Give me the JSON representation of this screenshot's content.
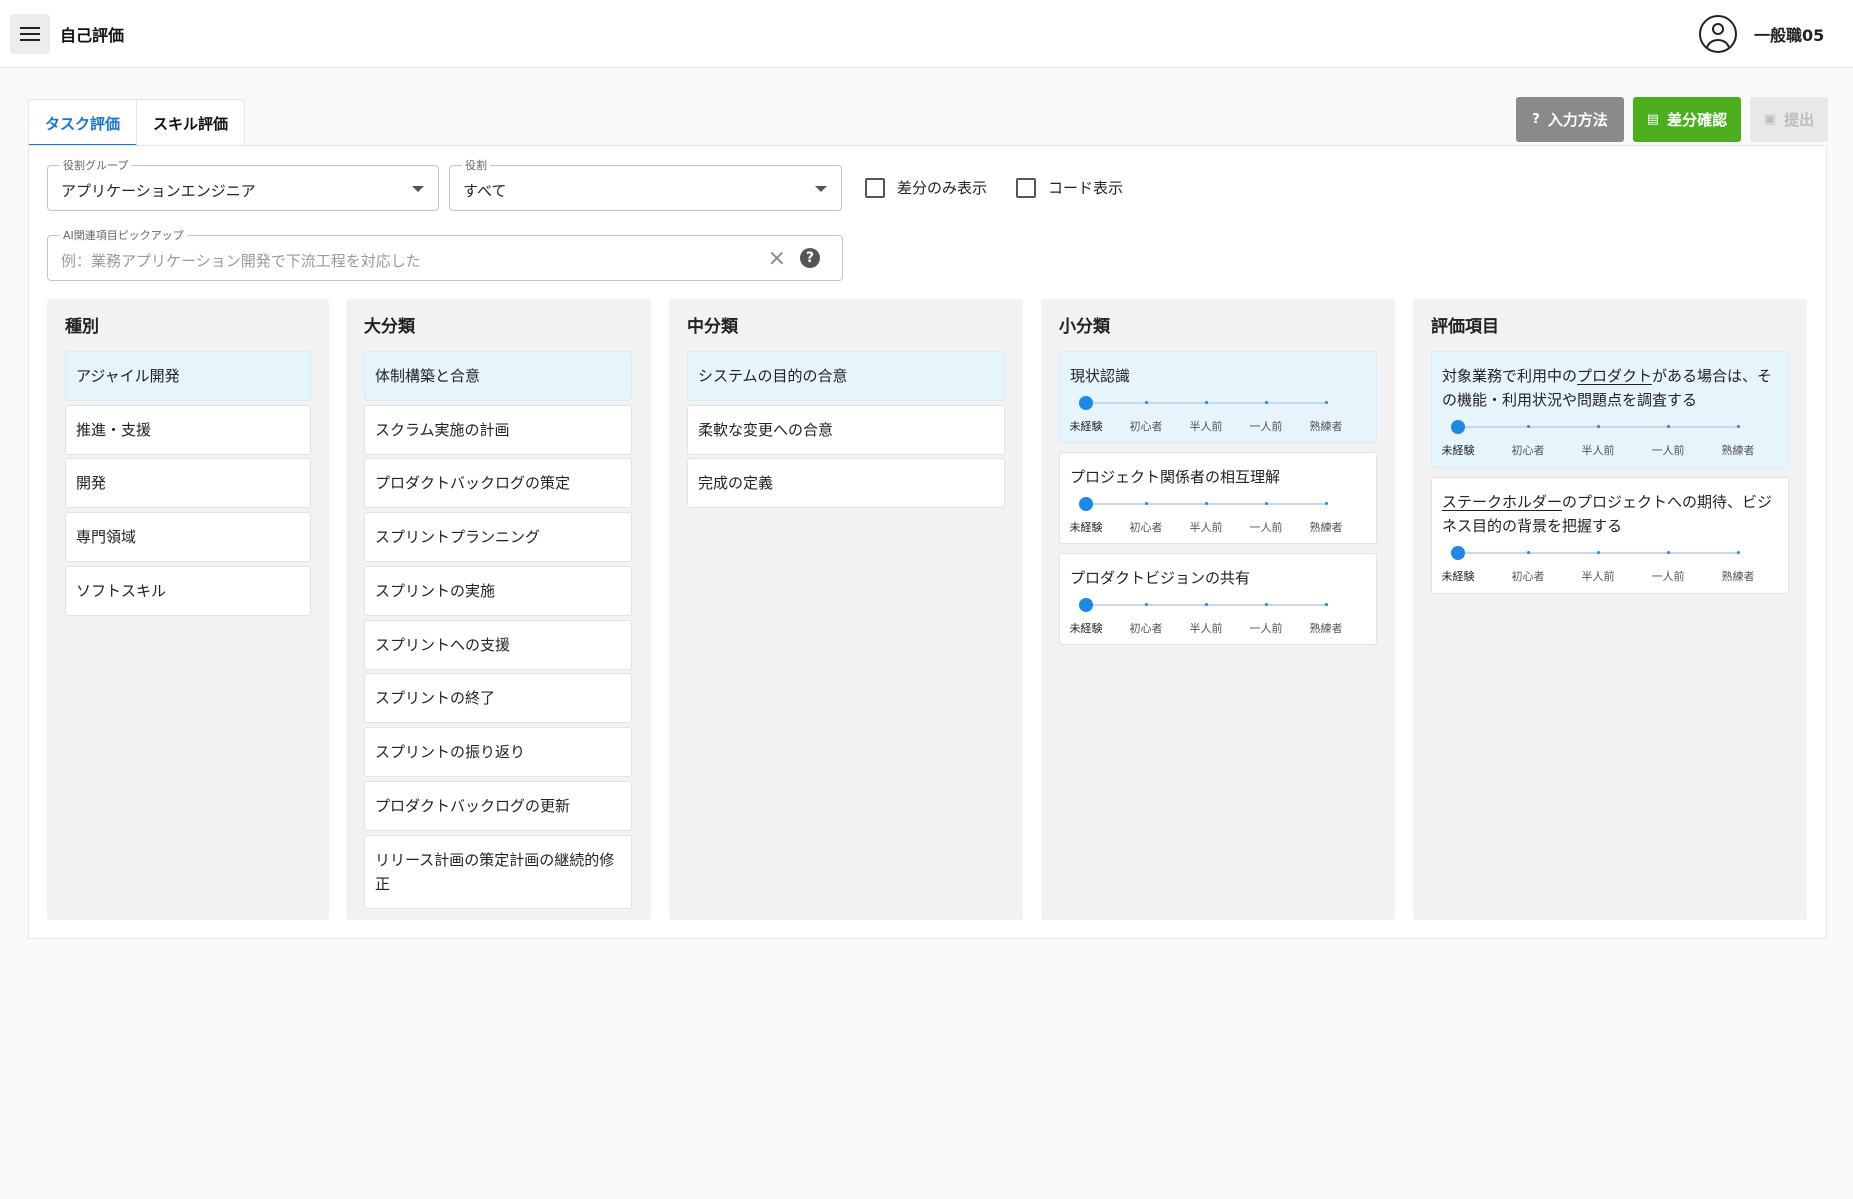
{
  "header": {
    "title": "自己評価",
    "user_name": "一般職05"
  },
  "tabs": [
    {
      "label": "タスク評価"
    },
    {
      "label": "スキル評価"
    }
  ],
  "actions": {
    "howto": "入力方法",
    "diff": "差分確認",
    "submit": "提出"
  },
  "filters": {
    "role_group": {
      "label": "役割グループ",
      "value": "アプリケーションエンジニア"
    },
    "role": {
      "label": "役割",
      "value": "すべて"
    },
    "diff_only": "差分のみ表示",
    "show_code": "コード表示",
    "ai_pickup": {
      "label": "AI関連項目ピックアップ",
      "placeholder": "例：業務アプリケーション開発で下流工程を対応した"
    }
  },
  "columns": {
    "type": {
      "title": "種別",
      "items": [
        "アジャイル開発",
        "推進・支援",
        "開発",
        "専門領域",
        "ソフトスキル"
      ]
    },
    "major": {
      "title": "大分類",
      "items": [
        "体制構築と合意",
        "スクラム実施の計画",
        "プロダクトバックログの策定",
        "スプリントプランニング",
        "スプリントの実施",
        "スプリントへの支援",
        "スプリントの終了",
        "スプリントの振り返り",
        "プロダクトバックログの更新",
        "リリース計画の策定計画の継続的修正"
      ]
    },
    "middle": {
      "title": "中分類",
      "items": [
        "システムの目的の合意",
        "柔軟な変更への合意",
        "完成の定義"
      ]
    },
    "minor": {
      "title": "小分類",
      "items": [
        {
          "label": "現状認識",
          "level": 0
        },
        {
          "label": "プロジェクト関係者の相互理解",
          "level": 0
        },
        {
          "label": "プロダクトビジョンの共有",
          "level": 0
        }
      ]
    },
    "eval": {
      "title": "評価項目",
      "items": [
        {
          "pre": "対象業務で利用中の",
          "link": "プロダクト",
          "post": "がある場合は、その機能・利用状況や問題点を調査する",
          "level": 0
        },
        {
          "pre": "",
          "link": "ステークホルダー",
          "post": "のプロジェクトへの期待、ビジネス目的の背景を把握する",
          "level": 0
        }
      ]
    }
  },
  "levels": [
    "未経験",
    "初心者",
    "半人前",
    "一人前",
    "熟練者"
  ]
}
